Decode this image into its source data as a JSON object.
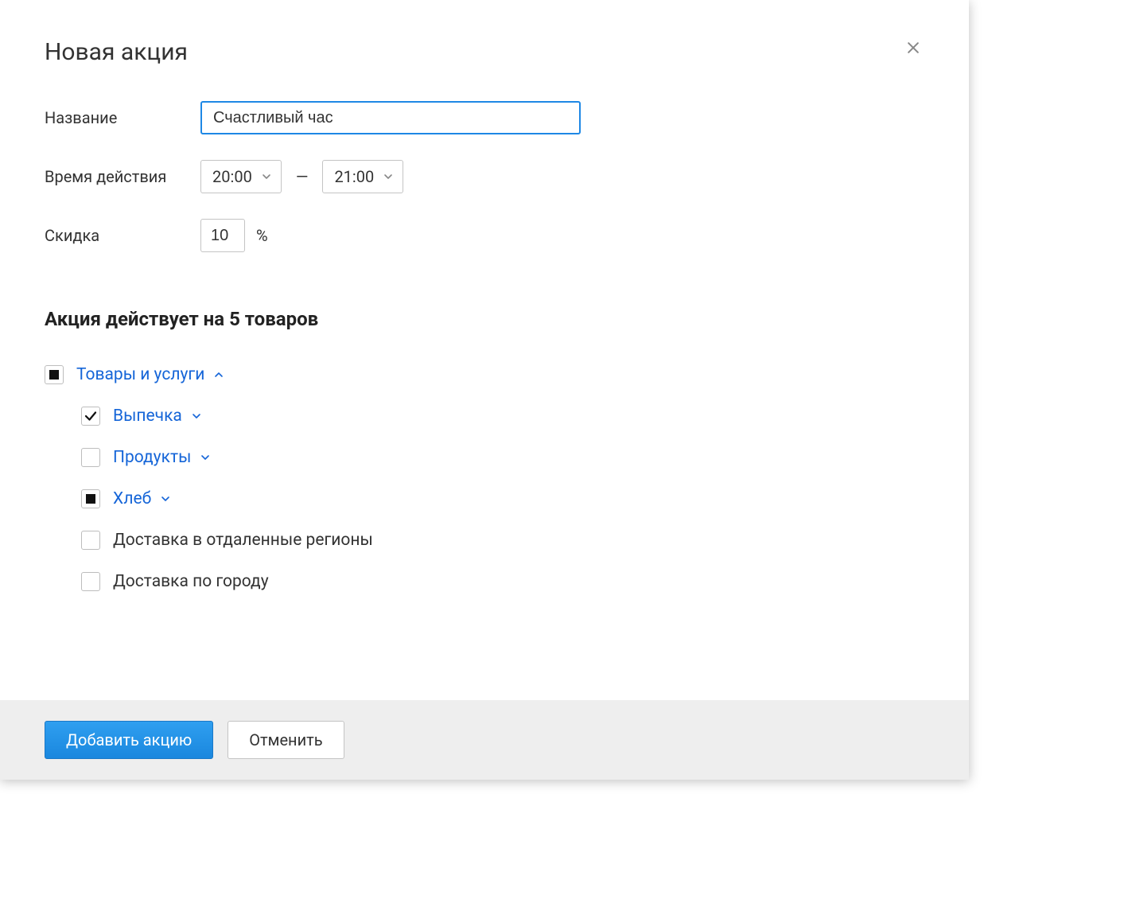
{
  "dialog": {
    "title": "Новая акция"
  },
  "form": {
    "name_label": "Название",
    "name_value": "Счастливый час",
    "time_label": "Время действия",
    "time_from": "20:00",
    "time_sep": "—",
    "time_to": "21:00",
    "discount_label": "Скидка",
    "discount_value": "10",
    "discount_unit": "%"
  },
  "section": {
    "title": "Акция действует на 5 товаров"
  },
  "tree": {
    "root": {
      "label": "Товары и услуги",
      "state": "indeterminate",
      "expanded": true
    },
    "children": [
      {
        "label": "Выпечка",
        "state": "checked",
        "expandable": true,
        "link": true
      },
      {
        "label": "Продукты",
        "state": "unchecked",
        "expandable": true,
        "link": true
      },
      {
        "label": "Хлеб",
        "state": "indeterminate",
        "expandable": true,
        "link": true
      },
      {
        "label": "Доставка в отдаленные регионы",
        "state": "unchecked",
        "expandable": false,
        "link": false
      },
      {
        "label": "Доставка по городу",
        "state": "unchecked",
        "expandable": false,
        "link": false
      }
    ]
  },
  "footer": {
    "primary": "Добавить акцию",
    "secondary": "Отменить"
  }
}
